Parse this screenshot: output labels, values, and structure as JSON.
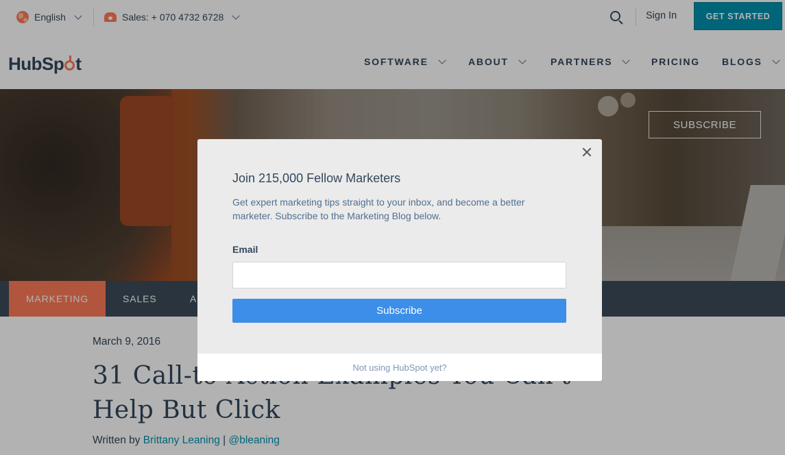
{
  "utility": {
    "language": "English",
    "sales_phone": "Sales: + 070 4732 6728",
    "sign_in": "Sign In",
    "get_started": "GET STARTED"
  },
  "brand": {
    "logo_text_left": "HubSp",
    "logo_text_right": "t"
  },
  "nav": {
    "items": [
      {
        "label": "SOFTWARE",
        "has_dropdown": true
      },
      {
        "label": "ABOUT",
        "has_dropdown": true
      },
      {
        "label": "PARTNERS",
        "has_dropdown": true
      },
      {
        "label": "PRICING",
        "has_dropdown": false
      },
      {
        "label": "BLOGS",
        "has_dropdown": true
      }
    ]
  },
  "hero": {
    "subscribe_label": "SUBSCRIBE"
  },
  "categories": {
    "tabs": [
      {
        "label": "MARKETING",
        "active": true
      },
      {
        "label": "SALES",
        "active": false
      },
      {
        "label": "A",
        "active": false
      }
    ]
  },
  "article": {
    "date": "March 9, 2016",
    "title_line1": "31 Call-to-Action Examples You Can't",
    "title_line2": "Help But Click",
    "byline_prefix": "Written by ",
    "author": "Brittany Leaning",
    "separator": " | ",
    "handle": "@bleaning"
  },
  "modal": {
    "heading": "Join 215,000 Fellow Marketers",
    "description": "Get expert marketing tips straight to your inbox, and become a better marketer. Subscribe to the Marketing Blog below.",
    "email_label": "Email",
    "email_value": "",
    "email_placeholder": "",
    "subscribe_label": "Subscribe",
    "footer_text": "Not using HubSpot yet?"
  },
  "colors": {
    "brand_orange": "#ff7a59",
    "teal": "#0091ae",
    "subscribe_blue": "#3c8ee8",
    "dark_text": "#33475b"
  }
}
